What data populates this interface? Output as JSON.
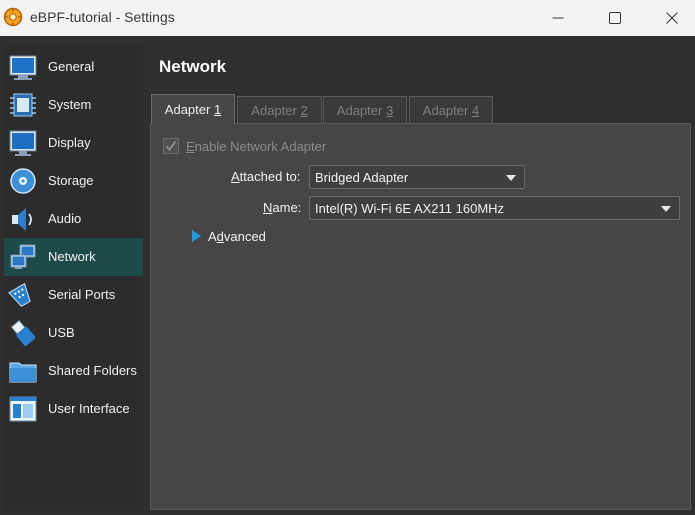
{
  "window": {
    "title": "eBPF-tutorial - Settings",
    "controls": [
      "minimize-icon",
      "maximize-icon",
      "close-icon"
    ]
  },
  "sidebar": {
    "items": [
      {
        "label": "General",
        "icon": "general-icon",
        "selected": false
      },
      {
        "label": "System",
        "icon": "system-icon",
        "selected": false
      },
      {
        "label": "Display",
        "icon": "display-icon",
        "selected": false
      },
      {
        "label": "Storage",
        "icon": "storage-icon",
        "selected": false
      },
      {
        "label": "Audio",
        "icon": "audio-icon",
        "selected": false
      },
      {
        "label": "Network",
        "icon": "network-icon",
        "selected": true
      },
      {
        "label": "Serial Ports",
        "icon": "serial-ports-icon",
        "selected": false
      },
      {
        "label": "USB",
        "icon": "usb-icon",
        "selected": false
      },
      {
        "label": "Shared Folders",
        "icon": "shared-folders-icon",
        "selected": false
      },
      {
        "label": "User Interface",
        "icon": "user-interface-icon",
        "selected": false
      }
    ]
  },
  "main": {
    "title": "Network",
    "tabs": [
      {
        "prefix": "Adapter ",
        "mnemonic": "1",
        "active": true
      },
      {
        "prefix": "Adapter ",
        "mnemonic": "2",
        "active": false
      },
      {
        "prefix": "Adapter ",
        "mnemonic": "3",
        "active": false
      },
      {
        "prefix": "Adapter ",
        "mnemonic": "4",
        "active": false
      }
    ],
    "enable_adapter": {
      "mnemonic": "E",
      "rest": "nable Network Adapter",
      "checked": true,
      "enabled": false
    },
    "attached_to": {
      "label_mnemonic": "A",
      "label_rest": "ttached to:",
      "value": "Bridged Adapter"
    },
    "name": {
      "label_mnemonic": "N",
      "label_rest": "ame:",
      "value": "Intel(R) Wi-Fi 6E AX211 160MHz"
    },
    "advanced": {
      "pre": "A",
      "mnemonic": "d",
      "rest": "vanced",
      "expanded": false
    }
  },
  "colors": {
    "selected_item_bg": "#1f4a4a",
    "panel_bg": "#464646",
    "window_bg": "#2f2f2f",
    "titlebar_bg": "#f3f3f3",
    "accent_blue": "#1e9be0"
  }
}
